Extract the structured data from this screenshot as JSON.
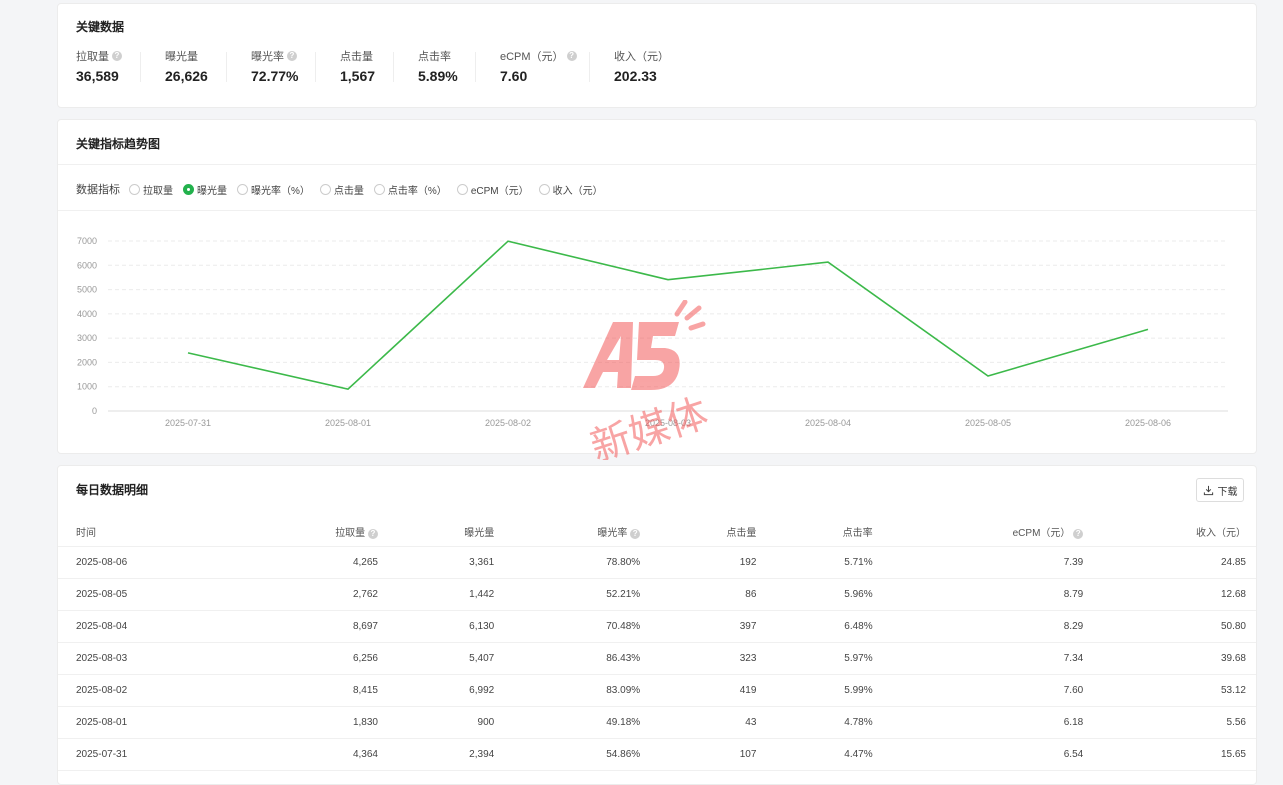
{
  "metrics": {
    "title": "关键数据",
    "items": [
      {
        "label": "拉取量",
        "value": "36,589",
        "help": true
      },
      {
        "label": "曝光量",
        "value": "26,626",
        "help": false
      },
      {
        "label": "曝光率",
        "value": "72.77%",
        "help": true
      },
      {
        "label": "点击量",
        "value": "1,567",
        "help": false
      },
      {
        "label": "点击率",
        "value": "5.89%",
        "help": false
      },
      {
        "label": "eCPM（元）",
        "value": "7.60",
        "help": true
      },
      {
        "label": "收入（元）",
        "value": "202.33",
        "help": false
      }
    ]
  },
  "trend": {
    "title": "关键指标趋势图",
    "radio_label": "数据指标",
    "options": [
      "拉取量",
      "曝光量",
      "曝光率（%）",
      "点击量",
      "点击率（%）",
      "eCPM（元）",
      "收入（元）"
    ],
    "selected": "曝光量"
  },
  "chart_data": {
    "type": "line",
    "categories": [
      "2025-07-31",
      "2025-08-01",
      "2025-08-02",
      "2025-08-03",
      "2025-08-04",
      "2025-08-05",
      "2025-08-06"
    ],
    "series": [
      {
        "values": [
          2394,
          900,
          6992,
          5407,
          6130,
          1442,
          3361
        ]
      }
    ],
    "ylim": [
      0,
      7000
    ],
    "yticks": [
      0,
      1000,
      2000,
      3000,
      4000,
      5000,
      6000,
      7000
    ],
    "grid": true,
    "line_color": "#3cb94a"
  },
  "watermark": {
    "logo": "A5",
    "text": "新媒体",
    "color": "#f35b5b"
  },
  "daily": {
    "title": "每日数据明细",
    "download_label": "下载",
    "columns": [
      "时间",
      "拉取量",
      "曝光量",
      "曝光率",
      "点击量",
      "点击率",
      "eCPM（元）",
      "收入（元）"
    ],
    "rows": [
      [
        "2025-08-06",
        "4,265",
        "3,361",
        "78.80%",
        "192",
        "5.71%",
        "7.39",
        "24.85"
      ],
      [
        "2025-08-05",
        "2,762",
        "1,442",
        "52.21%",
        "86",
        "5.96%",
        "8.79",
        "12.68"
      ],
      [
        "2025-08-04",
        "8,697",
        "6,130",
        "70.48%",
        "397",
        "6.48%",
        "8.29",
        "50.80"
      ],
      [
        "2025-08-03",
        "6,256",
        "5,407",
        "86.43%",
        "323",
        "5.97%",
        "7.34",
        "39.68"
      ],
      [
        "2025-08-02",
        "8,415",
        "6,992",
        "83.09%",
        "419",
        "5.99%",
        "7.60",
        "53.12"
      ],
      [
        "2025-08-01",
        "1,830",
        "900",
        "49.18%",
        "43",
        "4.78%",
        "6.18",
        "5.56"
      ],
      [
        "2025-07-31",
        "4,364",
        "2,394",
        "54.86%",
        "107",
        "4.47%",
        "6.54",
        "15.65"
      ]
    ]
  }
}
